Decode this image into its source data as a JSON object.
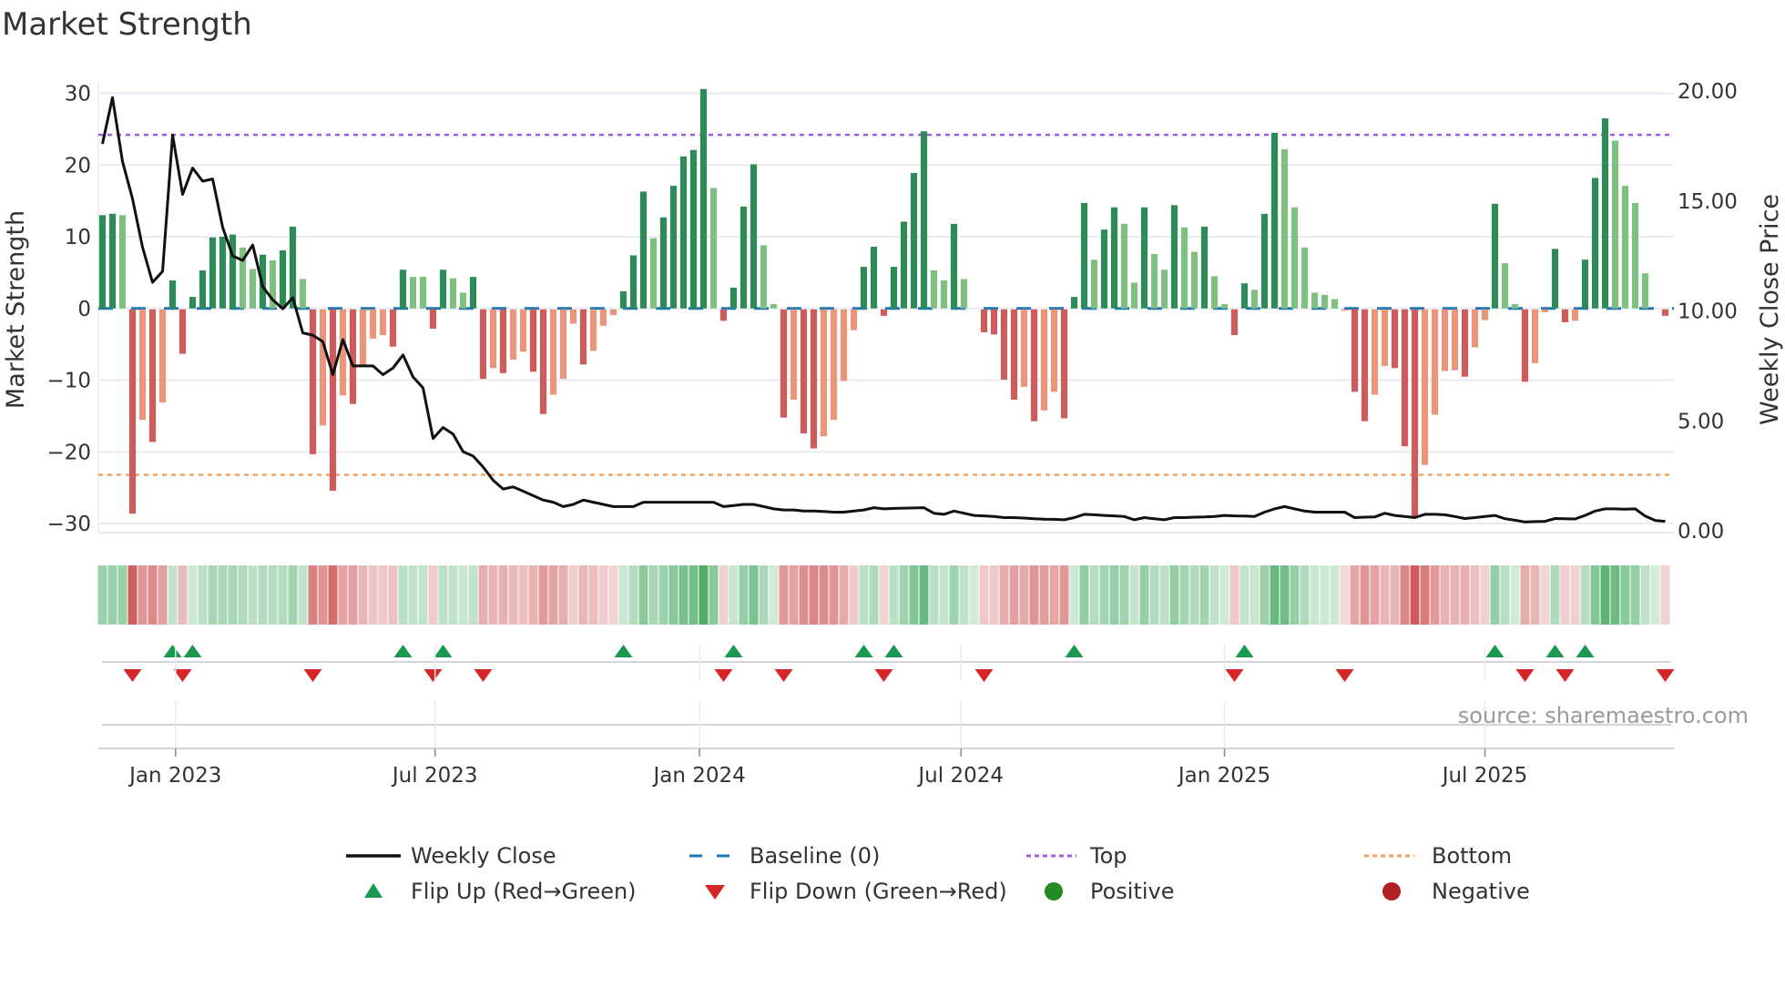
{
  "chart_data": {
    "type": "bar",
    "title": "Market Strength",
    "ylabel": "Market Strength",
    "y2label": "Weekly Close Price",
    "ylim": [
      -31,
      31
    ],
    "y2lim": [
      0,
      20.5
    ],
    "yticks": [
      30,
      20,
      10,
      0,
      -10,
      -20,
      -30
    ],
    "yticklabels": [
      "30",
      "20",
      "10",
      "0",
      "−10",
      "−20",
      "−30"
    ],
    "y2ticks": [
      20,
      15,
      10,
      5,
      0
    ],
    "y2ticklabels": [
      "20.00",
      "15.00",
      "10.00",
      "5.00",
      "0.00"
    ],
    "xticks": [
      {
        "label": "Jan 2023",
        "week": 7.3
      },
      {
        "label": "Jul 2023",
        "week": 33.2
      },
      {
        "label": "Jan 2024",
        "week": 59.6
      },
      {
        "label": "Jul 2024",
        "week": 85.7
      },
      {
        "label": "Jan 2025",
        "week": 112.0
      },
      {
        "label": "Jul 2025",
        "week": 138.0
      }
    ],
    "top_level": 24.2,
    "bottom_level": -23.2,
    "baseline": 0,
    "strength": [
      13.0,
      13.2,
      13.0,
      -28.5,
      -15.4,
      -18.5,
      -13,
      3.9,
      -6.2,
      1.6,
      5.3,
      9.9,
      10,
      10.3,
      8.5,
      5.5,
      7.5,
      6.7,
      8.1,
      11.4,
      4.1,
      -20.2,
      -16.2,
      -25.3,
      -12,
      -13.2,
      -7.8,
      -4.1,
      -3.6,
      -5.2,
      5.4,
      4.4,
      4.4,
      -2.7,
      5.4,
      4.2,
      2.2,
      4.4,
      -9.7,
      -8.2,
      -8.9,
      -7,
      -5.9,
      -8.7,
      -14.6,
      -11.9,
      -9.7,
      -2,
      -7.7,
      -5.8,
      -2.3,
      -0.8,
      2.4,
      7.4,
      16.3,
      9.8,
      12.7,
      17.1,
      21.2,
      22.1,
      30.6,
      16.8,
      -1.6,
      2.9,
      14.2,
      20.1,
      8.8,
      0.6,
      -15.1,
      -12.6,
      -17.3,
      -19.4,
      -17.7,
      -15.4,
      -10,
      -2.9,
      5.8,
      8.6,
      -0.9,
      5.8,
      12.1,
      18.9,
      24.7,
      5.3,
      3.9,
      11.8,
      4.1,
      0,
      -3.2,
      -3.5,
      -9.8,
      -12.6,
      -10.8,
      -15.6,
      -14.1,
      -11.5,
      -15.2,
      1.6,
      14.7,
      6.8,
      11,
      14.1,
      11.8,
      3.6,
      14.1,
      7.6,
      5.4,
      14.4,
      11.3,
      7.9,
      11.4,
      4.5,
      0.6,
      -3.6,
      3.5,
      2.6,
      13.2,
      24.5,
      22.2,
      14.1,
      8.5,
      2.2,
      1.9,
      1.3,
      -0.2,
      -11.5,
      -15.6,
      -11.9,
      -7.9,
      -8.2,
      -19.1,
      -29.1,
      -21.7,
      -14.7,
      -8.6,
      -8.5,
      -9.4,
      -5.3,
      -1.5,
      14.6,
      6.3,
      0.6,
      -10.1,
      -7.5,
      -0.4,
      8.3,
      -1.8,
      -1.6,
      6.8,
      18.2,
      26.5,
      23.4,
      17.1,
      14.7,
      4.9,
      0,
      -0.9
    ],
    "shade": "ddldldlddd",
    "shade_rest": "ddddlldlddldldldllld dllddllddldllddllldllldddldddddlddddlldlddlllldddddddlldlldd ddldlldddlddlldlldlldllddlddlllllllddllddd lllldlldlldlldd ldddllllld",
    "weekly_close": [
      17.6,
      19.7,
      16.8,
      15.1,
      12.9,
      11.3,
      11.8,
      18.0,
      15.3,
      16.5,
      15.9,
      16.0,
      13.8,
      12.5,
      12.3,
      13.0,
      11.1,
      10.5,
      10.1,
      10.6,
      9.0,
      8.9,
      8.6,
      7.1,
      8.7,
      7.5,
      7.5,
      7.5,
      7.1,
      7.4,
      8.0,
      7.0,
      6.5,
      4.2,
      4.7,
      4.4,
      3.6,
      3.4,
      2.9,
      2.3,
      1.9,
      2.0,
      1.8,
      1.6,
      1.4,
      1.3,
      1.1,
      1.2,
      1.4,
      1.3,
      1.2,
      1.1,
      1.1,
      1.1,
      1.3,
      1.3,
      1.3,
      1.3,
      1.3,
      1.3,
      1.3,
      1.3,
      1.1,
      1.15,
      1.2,
      1.2,
      1.1,
      1.0,
      0.95,
      0.95,
      0.9,
      0.9,
      0.88,
      0.85,
      0.85,
      0.9,
      0.95,
      1.05,
      1.0,
      1.02,
      1.03,
      1.04,
      1.05,
      0.8,
      0.75,
      0.9,
      0.8,
      0.7,
      0.68,
      0.65,
      0.6,
      0.6,
      0.58,
      0.55,
      0.53,
      0.52,
      0.5,
      0.6,
      0.75,
      0.73,
      0.7,
      0.68,
      0.65,
      0.5,
      0.6,
      0.55,
      0.5,
      0.6,
      0.6,
      0.62,
      0.63,
      0.65,
      0.7,
      0.68,
      0.67,
      0.65,
      0.85,
      1.0,
      1.1,
      1.0,
      0.9,
      0.85,
      0.85,
      0.85,
      0.85,
      0.6,
      0.62,
      0.63,
      0.8,
      0.7,
      0.65,
      0.6,
      0.75,
      0.75,
      0.73,
      0.65,
      0.56,
      0.6,
      0.65,
      0.7,
      0.55,
      0.48,
      0.4,
      0.42,
      0.43,
      0.56,
      0.55,
      0.54,
      0.7,
      0.9,
      1.0,
      1.0,
      0.98,
      1.0,
      0.67,
      0.47,
      0.43
    ],
    "legend": [
      {
        "label": "Weekly Close",
        "kind": "line"
      },
      {
        "label": "Baseline (0)",
        "kind": "dash"
      },
      {
        "label": "Top",
        "kind": "dot-top"
      },
      {
        "label": "Bottom",
        "kind": "dot-bottom"
      },
      {
        "label": "Flip Up (Red→Green)",
        "kind": "tri-up"
      },
      {
        "label": "Flip Down (Green→Red)",
        "kind": "tri-down"
      },
      {
        "label": "Positive",
        "kind": "circle-pos"
      },
      {
        "label": "Negative",
        "kind": "circle-neg"
      }
    ],
    "legend_position": "bottom-center",
    "grid": true
  },
  "source": "source: sharemaestro.com",
  "colors": {
    "pos_dark": "#2e8b57",
    "pos_light": "#7fbf7f",
    "neg_dark": "#cd5c5c",
    "neg_light": "#e9967a",
    "close": "#111111",
    "baseline": "#1f77b4",
    "top": "#9b5de5",
    "bottom": "#f4a261",
    "flip_up": "#1a9850",
    "flip_down": "#d62728",
    "positive": "#228b22",
    "negative": "#b22222"
  }
}
